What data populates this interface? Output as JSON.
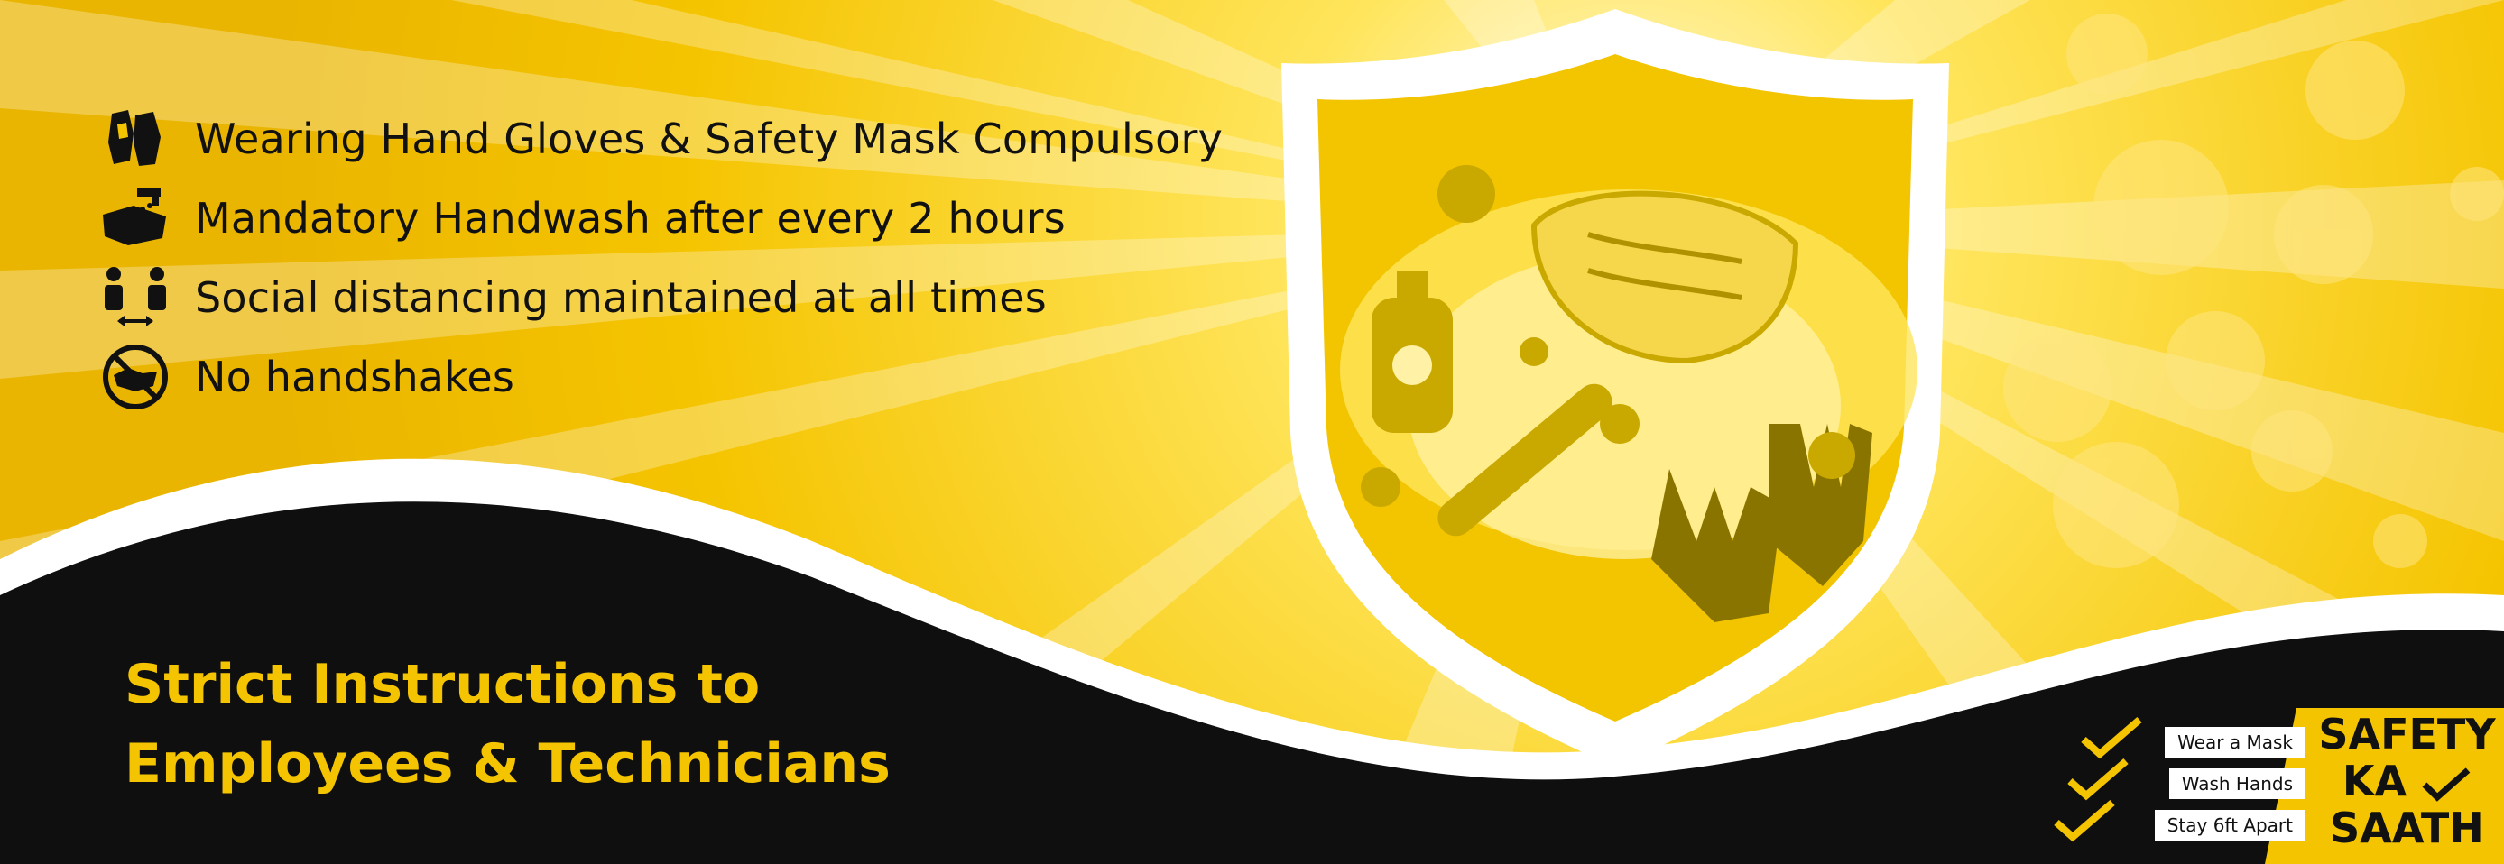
{
  "colors": {
    "yellow": "#f5c400",
    "yellow_light": "#ffe45c",
    "black": "#0f0f0f",
    "white": "#ffffff",
    "olive": "#8a7400"
  },
  "rules": [
    {
      "icon": "gloves-icon",
      "text": "Wearing Hand Gloves & Safety Mask Compulsory"
    },
    {
      "icon": "handwash-icon",
      "text": "Mandatory Handwash after every 2 hours"
    },
    {
      "icon": "social-distancing-icon",
      "text": "Social distancing maintained at all times"
    },
    {
      "icon": "no-handshake-icon",
      "text": "No handshakes"
    }
  ],
  "headline": {
    "line1": "Strict Instructions to",
    "line2": "Employees & Technicians"
  },
  "checklist": [
    {
      "label": "Wear a Mask"
    },
    {
      "label": "Wash Hands"
    },
    {
      "label": "Stay 6ft Apart"
    }
  ],
  "logo": {
    "line1": "SAFETY",
    "line2": "KA",
    "line3": "SAATH"
  }
}
